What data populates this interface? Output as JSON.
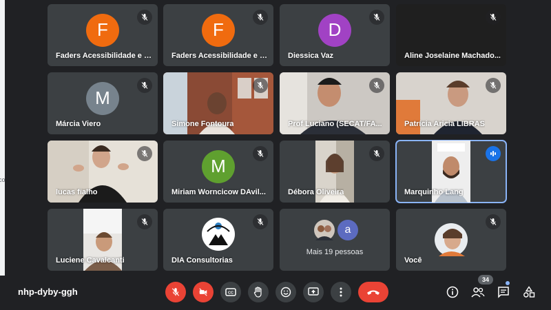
{
  "meeting": {
    "code": "nhp-dyby-ggh",
    "participant_count": "34"
  },
  "edge": {
    "fragment": "co"
  },
  "tiles": [
    {
      "name": "Faders Acessibilidade e I...",
      "initial": "F",
      "color": "#f06b0f"
    },
    {
      "name": "Faders Acessibilidade e I...",
      "initial": "F",
      "color": "#f06b0f"
    },
    {
      "name": "Diessica Vaz",
      "initial": "D",
      "color": "#a142c4"
    },
    {
      "name": "Aline Joselaine Machado..."
    },
    {
      "name": "Márcia Viero",
      "initial": "M",
      "color": "#77838d"
    },
    {
      "name": "Simone Fontoura"
    },
    {
      "name": "Prof Luciano (SECAT/FA..."
    },
    {
      "name": "Patrícia Aricia LIBRAS"
    },
    {
      "name": "lucas fialho"
    },
    {
      "name": "Miriam Worncicow DAvil...",
      "initial": "M",
      "color": "#5fa02f"
    },
    {
      "name": "Débora Oliveira"
    },
    {
      "name": "Marquinho Lang"
    },
    {
      "name": "Luciene Cavalcanti"
    },
    {
      "name": "DIA Consultorias"
    },
    {
      "name": "Mais 19 pessoas",
      "initial": "a",
      "color": "#5c6bc0"
    },
    {
      "name": "Você"
    }
  ],
  "controls": {
    "mic": {
      "icon": "mic-off-icon",
      "state": "off"
    },
    "camera": {
      "icon": "camera-off-icon",
      "state": "off"
    },
    "captions": {
      "icon": "captions-icon"
    },
    "raise_hand": {
      "icon": "hand-icon"
    },
    "reactions": {
      "icon": "emoji-icon"
    },
    "present": {
      "icon": "present-screen-icon"
    },
    "more": {
      "icon": "more-vert-icon"
    },
    "leave": {
      "icon": "phone-hangup-icon"
    }
  },
  "right_panel": [
    "info-icon",
    "people-icon",
    "chat-icon",
    "activities-icon"
  ],
  "colors": {
    "background": "#202124",
    "tile": "#3c4043",
    "red": "#ea4335",
    "active_border": "#8ab4f8",
    "speaking": "#1a73e8"
  }
}
